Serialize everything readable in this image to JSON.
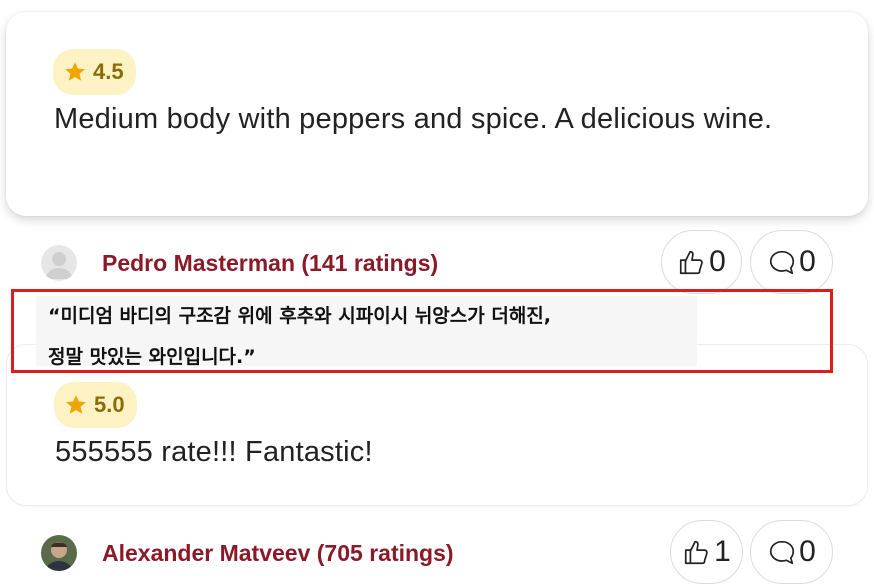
{
  "reviews": [
    {
      "rating": "4.5",
      "text": "Medium body with peppers and spice. A delicious wine."
    },
    {
      "rating": "5.0",
      "text": "555555 rate!!! Fantastic!"
    }
  ],
  "reviewers": [
    {
      "name": "Pedro Masterman (141 ratings)",
      "likes": "0",
      "comments": "0"
    },
    {
      "name": "Alexander Matveev (705 ratings)",
      "likes": "1",
      "comments": "0"
    }
  ],
  "translation_overlay": {
    "line1": "“미디엄 바디의 구조감 위에 후추와 시파이시 뉘앙스가 더해진,",
    "line2": "정말 맛있는 와인입니다.”"
  },
  "colors": {
    "reviewer_name": "#8b1a28",
    "badge_bg": "#fcf2c4",
    "star": "#f0a500",
    "highlight_border": "#e01b1b"
  },
  "icons": [
    "star-icon",
    "thumbs-up-icon",
    "comment-icon",
    "avatar-placeholder-icon"
  ]
}
